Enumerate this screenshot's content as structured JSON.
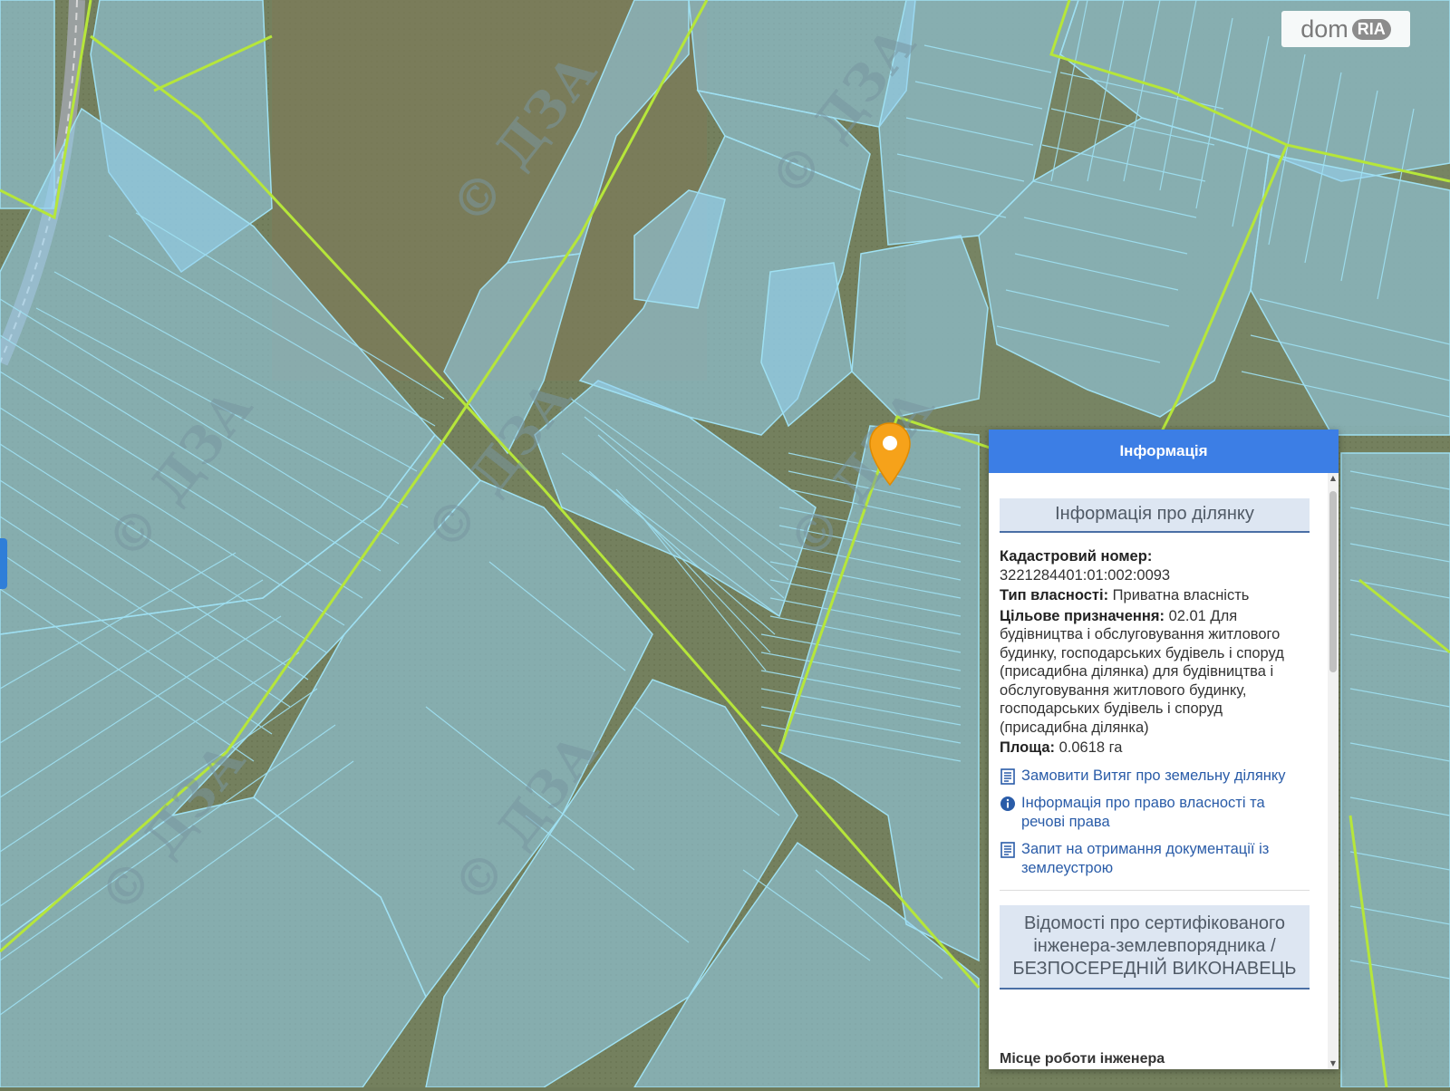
{
  "map": {
    "watermark_text": "© ДЗА",
    "logo": {
      "text": "dom",
      "badge": "RIA"
    },
    "marker_icon": "map-pin-icon"
  },
  "popup": {
    "header": "Інформація",
    "section_title": "Інформація про ділянку",
    "cadastral_label": "Кадастровий номер:",
    "cadastral_value": "3221284401:01:002:0093",
    "ownership_label": "Тип власності:",
    "ownership_value": "Приватна власність",
    "purpose_label": "Цільове призначення:",
    "purpose_value": "02.01 Для будівництва і обслуговування житлового будинку, господарських будівель і споруд (присадибна ділянка) для будівництва і обслуговування житлового будинку, господарських будівель і споруд (присадибна ділянка)",
    "area_label": "Площа:",
    "area_value": "0.0618 га",
    "links": [
      {
        "label": "Замовити Витяг про земельну ділянку",
        "icon": "document-icon"
      },
      {
        "label": "Інформація про право власності та речові права",
        "icon": "info-icon"
      },
      {
        "label": "Запит на отримання документації із землеустрою",
        "icon": "document-icon"
      }
    ],
    "engineer_section_title": "Відомості про сертифікованого інженера-землевпорядника / БЕЗПОСЕРЕДНІЙ ВИКОНАВЕЦЬ",
    "cut_text": "Місце роботи інженера"
  }
}
